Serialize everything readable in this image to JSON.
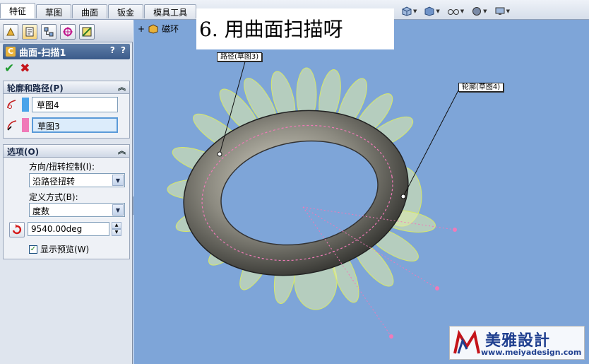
{
  "tabs": [
    "特征",
    "草图",
    "曲面",
    "钣金",
    "模具工具"
  ],
  "feature_manager": {
    "title": "曲面-扫描1",
    "help": "? ?",
    "ok_symbol": "✔",
    "cancel_symbol": "✖"
  },
  "profile_path": {
    "header": "轮廓和路径(P)",
    "profile_value": "草图4",
    "path_value": "草图3",
    "profile_color": "#4aa4ea",
    "path_color": "#f07ab8"
  },
  "options": {
    "header": "选项(O)",
    "direction_label": "方向/扭转控制(I):",
    "direction_value": "沿路径扭转",
    "define_label": "定义方式(B):",
    "define_value": "度数",
    "twist_value": "9540.00deg",
    "preview_label": "显示预览(W)"
  },
  "viewport": {
    "tree_root": "磁环",
    "callout_path": "路径(草图3)",
    "callout_profile": "轮廓(草图4)",
    "caption": "6. 用曲面扫描呀",
    "background": "#7ea5d8"
  },
  "brand": {
    "name": "美雅設計",
    "url": "www.meiyadesign.com"
  },
  "icons": [
    "property-manager-icon",
    "config-icon",
    "sweep-feature-icon",
    "sketch-profile-icon",
    "sketch-path-icon",
    "reverse-direction-icon",
    "part-icon"
  ]
}
